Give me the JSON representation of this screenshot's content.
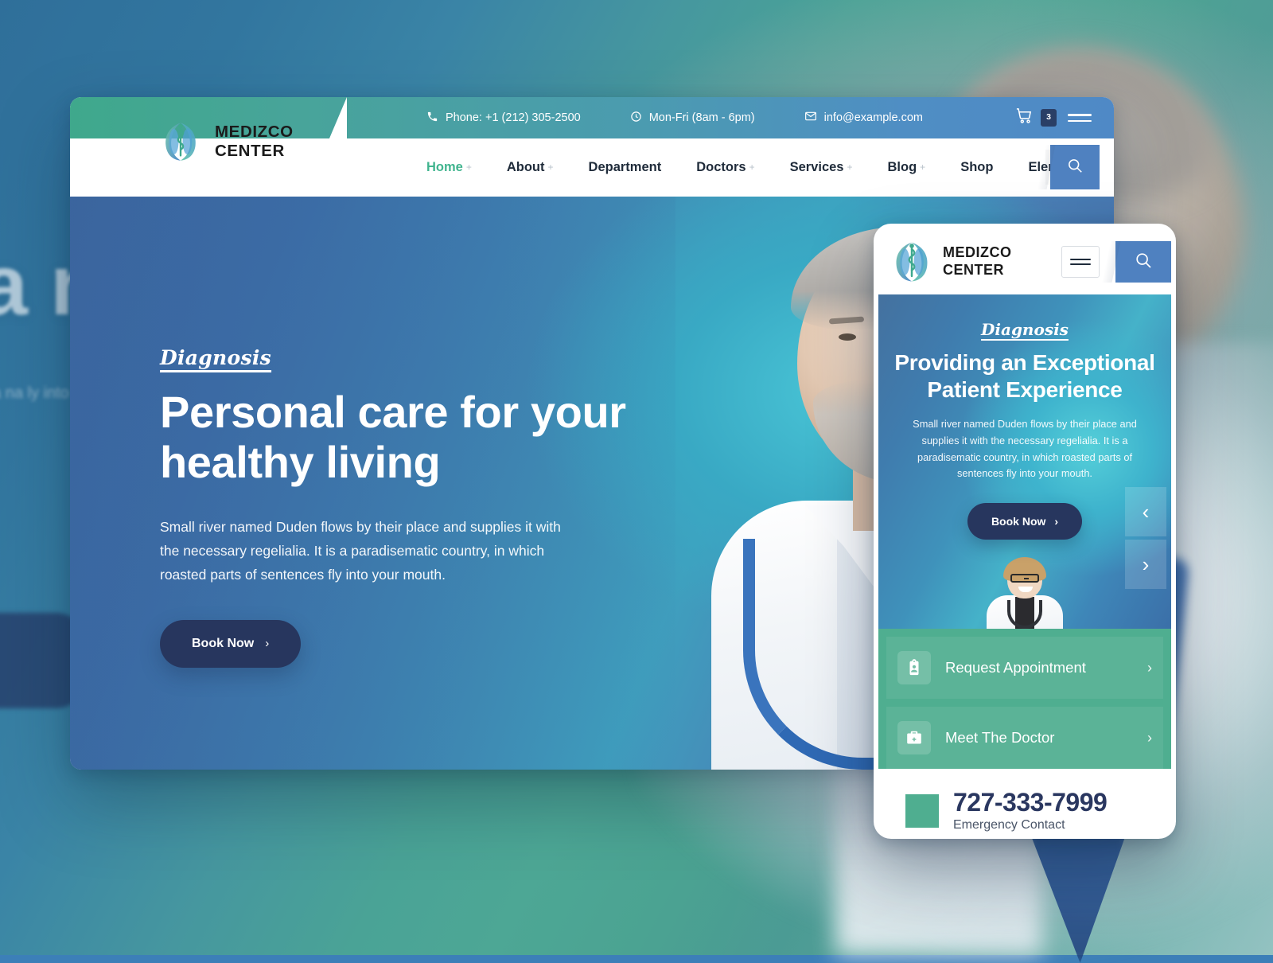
{
  "brand": {
    "name_line1": "MEDIZCO",
    "name_line2": "CENTER",
    "logo_icon": "caduceus-leaf-logo"
  },
  "desktop": {
    "topbar": {
      "phone": "Phone: +1 (212) 305-2500",
      "phone_icon": "phone-icon",
      "hours": "Mon-Fri (8am - 6pm)",
      "hours_icon": "clock-icon",
      "email": "info@example.com",
      "email_icon": "envelope-icon",
      "cart_icon": "cart-icon",
      "cart_count": "3",
      "menu_icon": "hamburger-icon"
    },
    "nav": [
      {
        "label": "Home",
        "has_submenu": true,
        "active": true
      },
      {
        "label": "About",
        "has_submenu": true,
        "active": false
      },
      {
        "label": "Department",
        "has_submenu": false,
        "active": false
      },
      {
        "label": "Doctors",
        "has_submenu": true,
        "active": false
      },
      {
        "label": "Services",
        "has_submenu": true,
        "active": false
      },
      {
        "label": "Blog",
        "has_submenu": true,
        "active": false
      },
      {
        "label": "Shop",
        "has_submenu": false,
        "active": false
      },
      {
        "label": "Elements",
        "has_submenu": true,
        "active": false
      }
    ],
    "submenu_marker": "+",
    "search_icon": "search-icon",
    "hero": {
      "eyebrow": "Diagnosis",
      "title": "Personal care for your healthy living",
      "description": "Small river named Duden flows by their place and supplies it with the necessary regelialia. It is a paradisematic country, in which roasted parts of sentences fly into your mouth.",
      "cta_label": "Book Now",
      "cta_chevron": "›"
    }
  },
  "phone": {
    "menu_icon": "hamburger-icon",
    "search_icon": "search-icon",
    "hero": {
      "eyebrow": "Diagnosis",
      "title": "Providing an Exceptional Patient Experience",
      "description": "Small river named Duden flows by their place and supplies it with the necessary regelialia. It is a paradisematic country, in which roasted parts of sentences fly into your mouth.",
      "cta_label": "Book Now",
      "cta_chevron": "›",
      "prev_icon": "chevron-left-icon",
      "next_icon": "chevron-right-icon"
    },
    "actions": [
      {
        "label": "Request Appointment",
        "icon": "clipboard-user-icon",
        "chevron": "›"
      },
      {
        "label": "Meet The Doctor",
        "icon": "medical-bag-icon",
        "chevron": "›"
      }
    ],
    "emergency": {
      "icon": "emergency-block-icon",
      "number": "727-333-7999",
      "label": "Emergency Contact"
    }
  },
  "background": {
    "ghost_title": "na ny",
    "ghost_paragraph": "Duden fl  a na  ly into"
  },
  "colors": {
    "teal": "#4fae90",
    "blue_accent": "#4f81c0",
    "navy": "#27365e",
    "nav_active": "#40b48e",
    "emergency_number": "#2a3760"
  }
}
